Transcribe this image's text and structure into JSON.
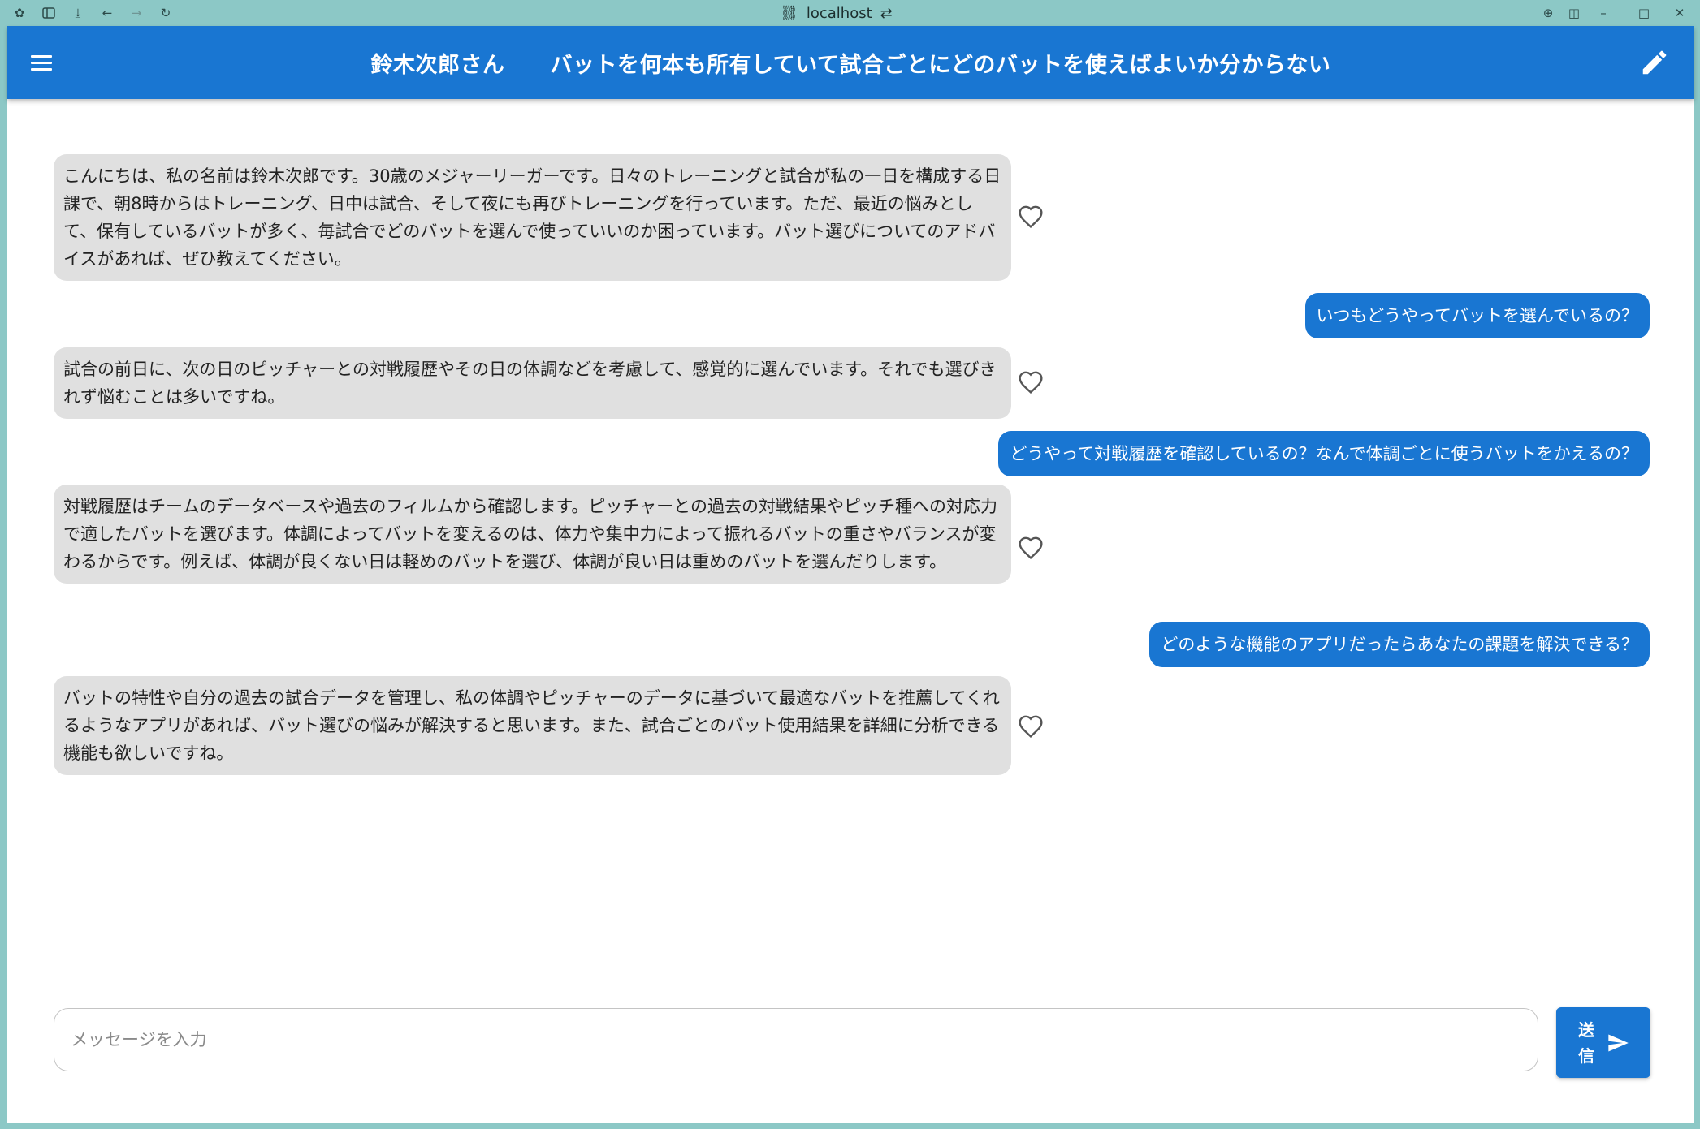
{
  "browser": {
    "url": "localhost",
    "icons": [
      "app-icon",
      "sidebar-toggle-icon",
      "download-icon",
      "back-icon",
      "forward-icon",
      "reload-icon",
      "link-icon",
      "settings-icon",
      "globe-icon",
      "split-view-icon",
      "minimize-icon",
      "maximize-icon",
      "close-icon"
    ]
  },
  "appbar": {
    "name": "鈴木次郎さん",
    "problem": "バットを何本も所有していて試合ごとにどのバットを使えばよいか分からない"
  },
  "messages": [
    {
      "role": "persona",
      "text": "こんにちは、私の名前は鈴木次郎です。30歳のメジャーリーガーです。日々のトレーニングと試合が私の一日を構成する日課で、朝8時からはトレーニング、日中は試合、そして夜にも再びトレーニングを行っています。ただ、最近の悩みとして、保有しているバットが多く、毎試合でどのバットを選んで使っていいのか困っています。バット選びについてのアドバイスがあれば、ぜひ教えてください。"
    },
    {
      "role": "user",
      "text": "いつもどうやってバットを選んでいるの？"
    },
    {
      "role": "persona",
      "text": "試合の前日に、次の日のピッチャーとの対戦履歴やその日の体調などを考慮して、感覚的に選んでいます。それでも選びきれず悩むことは多いですね。"
    },
    {
      "role": "user",
      "text": "どうやって対戦履歴を確認しているの？なんで体調ごとに使うバットをかえるの？"
    },
    {
      "role": "persona",
      "text": "対戦履歴はチームのデータベースや過去のフィルムから確認します。ピッチャーとの過去の対戦結果やピッチ種への対応力で適したバットを選びます。体調によってバットを変えるのは、体力や集中力によって振れるバットの重さやバランスが変わるからです。例えば、体調が良くない日は軽めのバットを選び、体調が良い日は重めのバットを選んだりします。"
    },
    {
      "role": "user",
      "text": "どのような機能のアプリだったらあなたの課題を解決できる？"
    },
    {
      "role": "persona",
      "text": "バットの特性や自分の過去の試合データを管理し、私の体調やピッチャーのデータに基づいて最適なバットを推薦してくれるようなアプリがあれば、バット選びの悩みが解決すると思います。また、試合ごとのバット使用結果を詳細に分析できる機能も欲しいですね。"
    }
  ],
  "composer": {
    "placeholder": "メッセージを入力",
    "send_label": "送信"
  },
  "colors": {
    "primary": "#1976d2",
    "persona_bubble": "#e0e0e0",
    "window_frame": "#8cc8c6"
  }
}
